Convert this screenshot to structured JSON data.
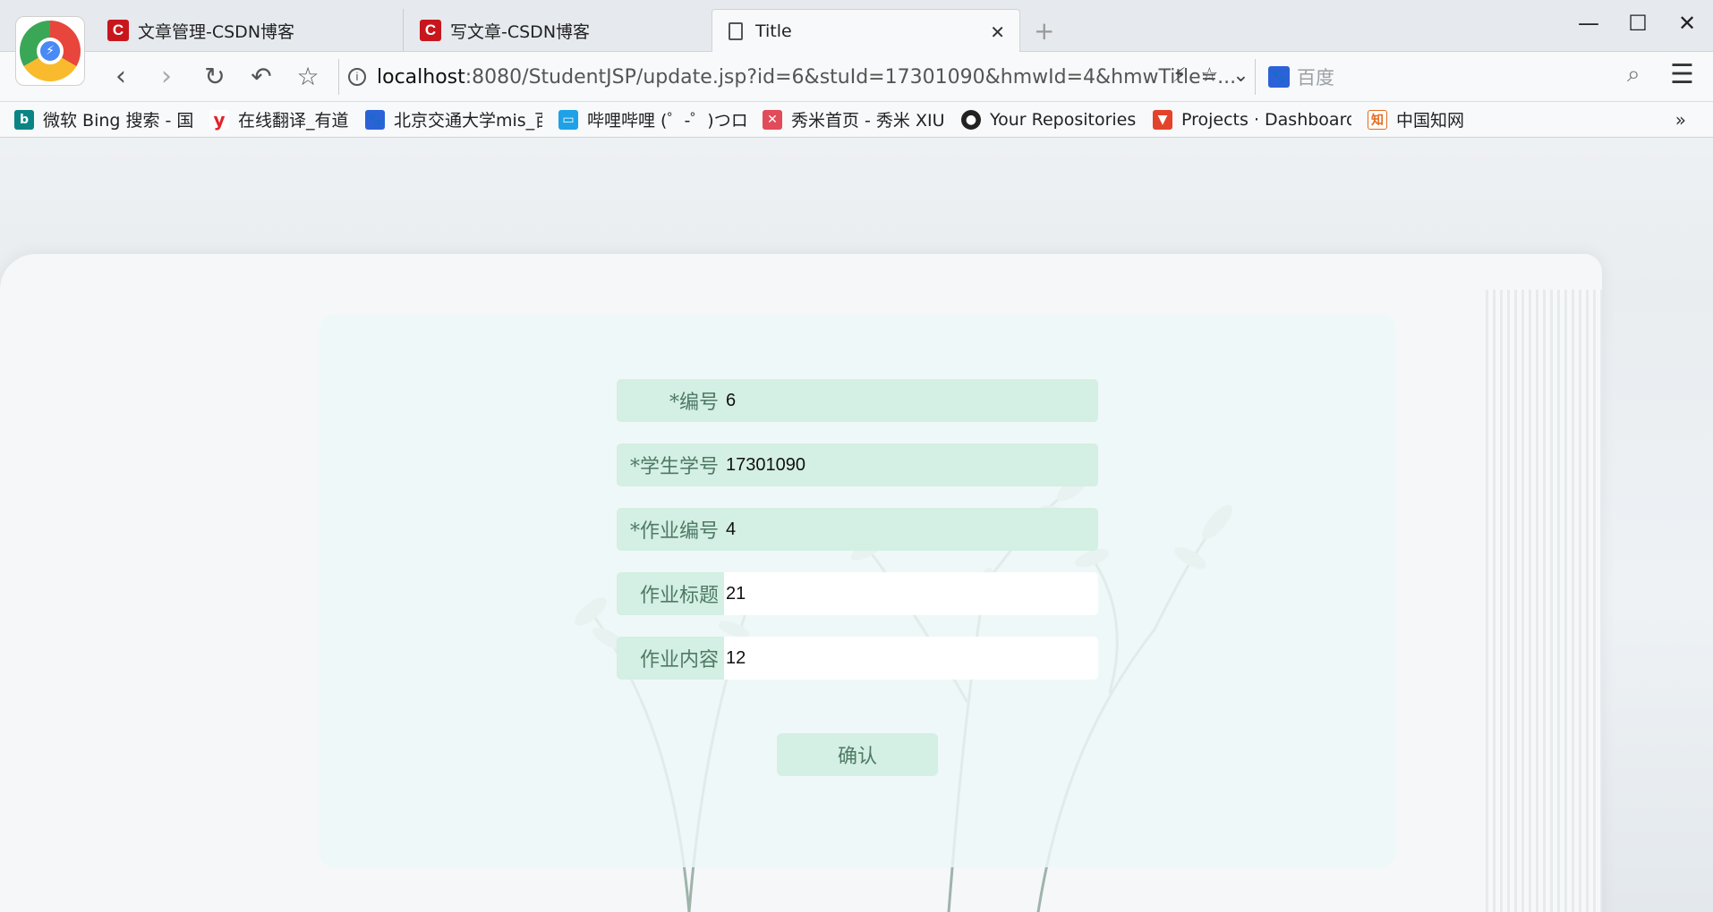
{
  "browser": {
    "tabs": [
      {
        "title": "文章管理-CSDN博客",
        "favicon": "csdn-icon"
      },
      {
        "title": "写文章-CSDN博客",
        "favicon": "csdn-icon"
      },
      {
        "title": "Title",
        "favicon": "page-icon"
      }
    ],
    "url_host": "localhost",
    "url_rest": ":8080/StudentJSP/update.jsp?id=6&stuId=17301090&hmwId=4&hmwTitle=...",
    "search_placeholder": "百度"
  },
  "bookmarks": [
    {
      "label": "微软 Bing 搜索 - 国内",
      "icon": "bing-icon",
      "color": "#0b8484"
    },
    {
      "label": "在线翻译_有道",
      "icon": "youdao-icon",
      "color": "#e2242a"
    },
    {
      "label": "北京交通大学mis_百度",
      "icon": "baidu-paw-icon",
      "color": "#2c62d8"
    },
    {
      "label": "哔哩哔哩 (゜-゜)つロ",
      "icon": "bilibili-icon",
      "color": "#1ea1e6"
    },
    {
      "label": "秀米首页 - 秀米 XIUMI",
      "icon": "xiumi-icon",
      "color": "#e24b5a"
    },
    {
      "label": "Your Repositories",
      "icon": "github-icon",
      "color": "#222222"
    },
    {
      "label": "Projects · Dashboard",
      "icon": "gitlab-icon",
      "color": "#e2432a"
    },
    {
      "label": "中国知网",
      "icon": "cnki-icon",
      "color": "#e46b1f"
    }
  ],
  "form": {
    "fields": [
      {
        "label": "*编号",
        "value": "6",
        "editable": false
      },
      {
        "label": "*学生学号",
        "value": "17301090",
        "editable": false
      },
      {
        "label": "*作业编号",
        "value": "4",
        "editable": false
      },
      {
        "label": "作业标题",
        "value": "21",
        "editable": true
      },
      {
        "label": "作业内容",
        "value": "12",
        "editable": true
      }
    ],
    "submit_label": "确认"
  }
}
